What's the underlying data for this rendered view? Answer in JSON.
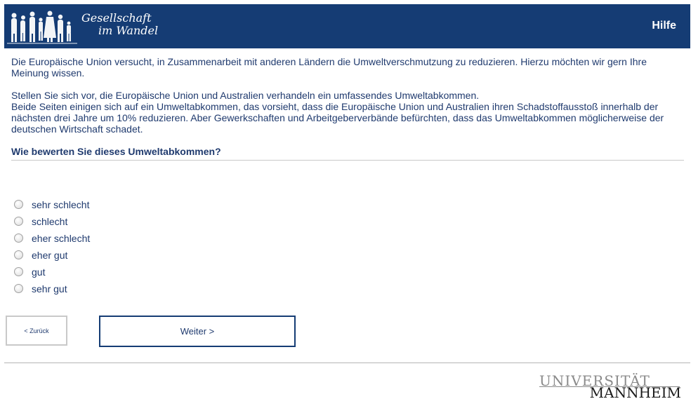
{
  "header": {
    "logo_line1": "Gesellschaft",
    "logo_line2": "im Wandel",
    "help_label": "Hilfe",
    "bg_color": "#153c74"
  },
  "intro": {
    "p1": "Die Europäische Union versucht, in Zusammenarbeit mit anderen Ländern die Umweltverschmutzung zu reduzieren. Hierzu möchten wir gern Ihre Meinung wissen.",
    "p2_line1": "Stellen Sie sich vor, die Europäische Union und Australien verhandeln ein umfassendes Umweltabkommen.",
    "p2_line2": "Beide Seiten einigen sich auf ein Umweltabkommen, das vorsieht, dass die Europäische Union und Australien ihren Schadstoffausstoß innerhalb der nächsten drei Jahre um 10% reduzieren. Aber Gewerkschaften und Arbeitgeberverbände befürchten, dass das Umweltabkommen möglicherweise der deutschen Wirtschaft schadet."
  },
  "question": "Wie bewerten Sie dieses Umweltabkommen?",
  "options": [
    "sehr schlecht",
    "schlecht",
    "eher schlecht",
    "eher gut",
    "gut",
    "sehr gut"
  ],
  "nav": {
    "back_label": "< Zurück",
    "next_label": "Weiter >"
  },
  "footer": {
    "logo_line1": "UNIVERSITÄT",
    "logo_line2": "MANNHEIM"
  }
}
